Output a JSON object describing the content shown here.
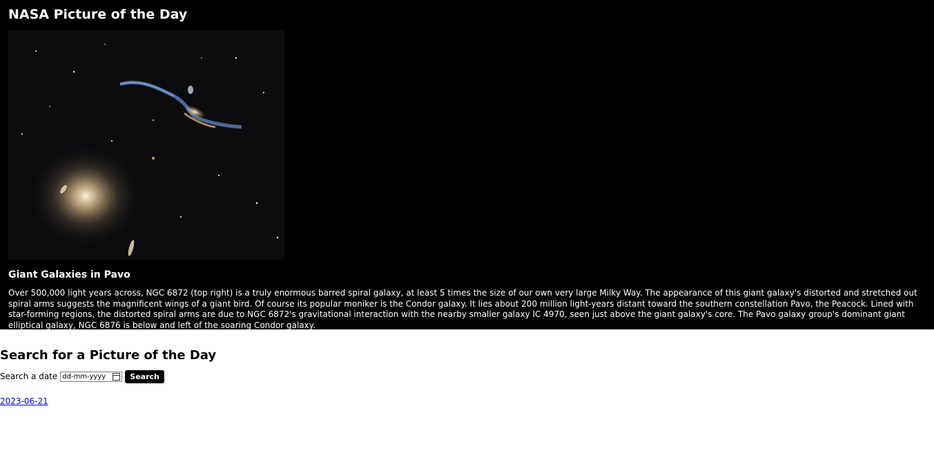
{
  "header": {
    "title": "NASA Picture of the Day"
  },
  "apod": {
    "title": "Giant Galaxies in Pavo",
    "description": "Over 500,000 light years across, NGC 6872 (top right) is a truly enormous barred spiral galaxy, at least 5 times the size of our own very large Milky Way. The appearance of this giant galaxy's distorted and stretched out spiral arms suggests the magnificent wings of a giant bird. Of course its popular moniker is the Condor galaxy. It lies about 200 million light-years distant toward the southern constellation Pavo, the Peacock. Lined with star-forming regions, the distorted spiral arms are due to NGC 6872's gravitational interaction with the nearby smaller galaxy IC 4970, seen just above the giant galaxy's core. The Pavo galaxy group's dominant giant elliptical galaxy, NGC 6876 is below and left of the soaring Condor galaxy."
  },
  "search": {
    "title": "Search for a Picture of the Day",
    "label": "Search a date",
    "placeholder": "dd-mm-yyyy",
    "button": "Search",
    "result_link": "2023-06-21"
  }
}
